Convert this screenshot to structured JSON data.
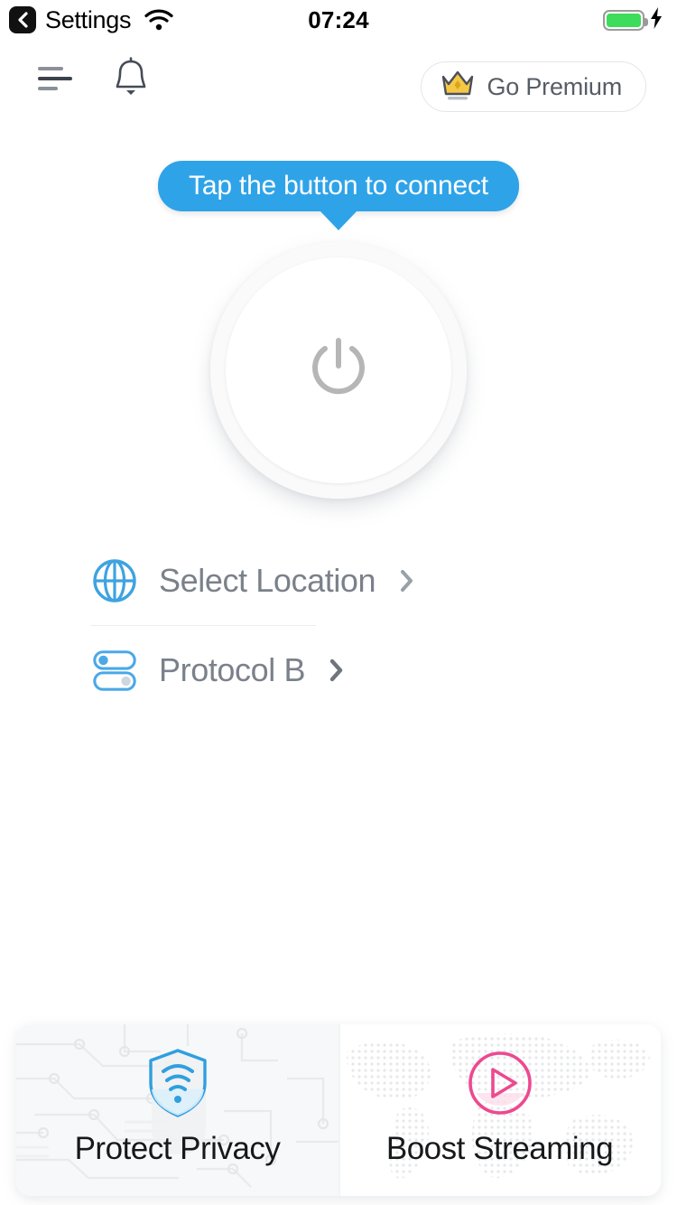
{
  "status_bar": {
    "back_label": "Settings",
    "back_icon": "chevron-left-icon",
    "wifi_icon": "wifi-icon",
    "time": "07:24",
    "battery_icon": "battery-full-icon",
    "charging_icon": "lightning-bolt-icon",
    "battery_color": "#3ddc5b"
  },
  "top_bar": {
    "menu_icon": "hamburger-menu-icon",
    "bell_icon": "notification-bell-icon",
    "premium": {
      "label": "Go Premium",
      "icon": "crown-icon",
      "crown_color": "#f6c744"
    }
  },
  "tooltip": {
    "text": "Tap the button to connect",
    "color": "#2fa3e8"
  },
  "power_button": {
    "icon": "power-icon",
    "state": "disconnected",
    "icon_color": "#b6b6b6"
  },
  "options": [
    {
      "label": "Select Location",
      "icon": "globe-icon",
      "chevron": "chevron-right-icon",
      "icon_color": "#3ea3e0"
    },
    {
      "label": "Protocol B",
      "icon": "toggles-icon",
      "chevron": "chevron-right-icon",
      "icon_color": "#4aa8e8"
    }
  ],
  "cards": [
    {
      "label": "Protect Privacy",
      "icon": "shield-wifi-icon",
      "icon_color": "#2f9fe0",
      "background": "circuit-board-pattern"
    },
    {
      "label": "Boost Streaming",
      "icon": "play-circle-icon",
      "icon_color": "#ec4a90",
      "background": "dotted-world-map-pattern"
    }
  ]
}
